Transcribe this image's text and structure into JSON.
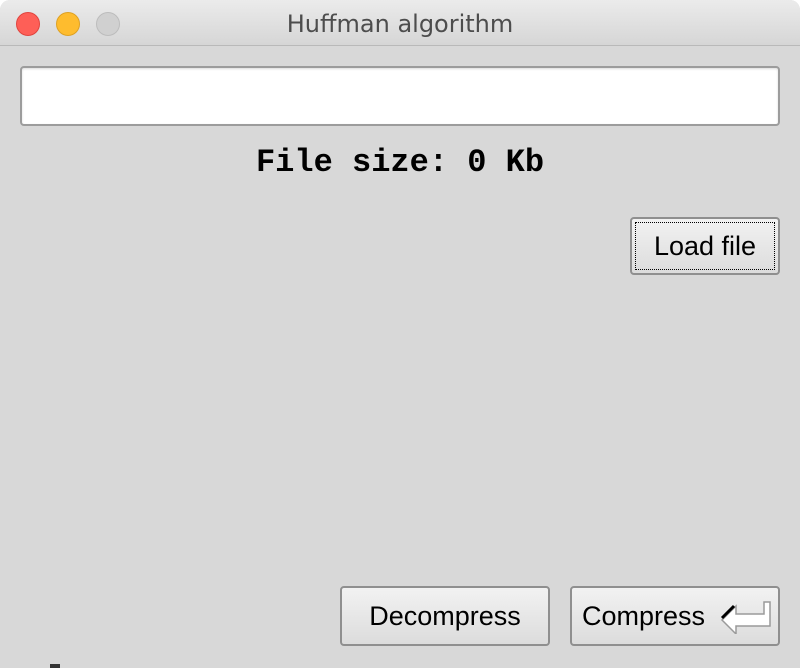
{
  "window": {
    "title": "Huffman algorithm"
  },
  "file_path": {
    "value": "",
    "placeholder": ""
  },
  "file_size": {
    "text": "File size: 0 Kb"
  },
  "buttons": {
    "load_file": "Load file",
    "decompress": "Decompress",
    "compress": "Compress"
  },
  "icons": {
    "return_key": "return-key-icon"
  },
  "colors": {
    "close": "#fe5f57",
    "minimize": "#febc2e",
    "zoom": "#d0d0d0",
    "window_bg": "#d8d8d8"
  }
}
